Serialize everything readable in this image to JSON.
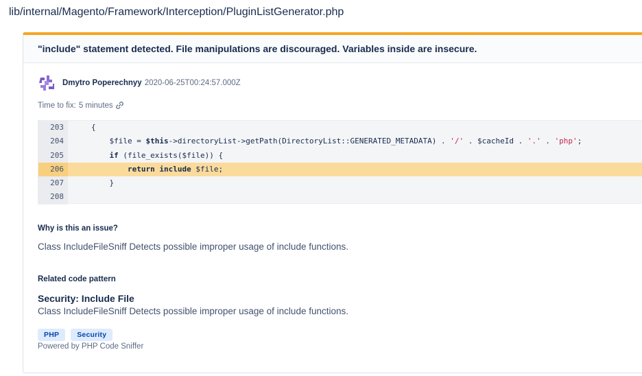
{
  "file": {
    "path": "lib/internal/Magento/Framework/Interception/PluginListGenerator.php"
  },
  "issue": {
    "title": "\"include\" statement detected. File manipulations are discouraged. Variables inside are insecure.",
    "author": "Dmytro Poperechnyy",
    "timestamp": "2020-06-25T00:24:57.000Z",
    "time_to_fix_label": "Time to fix:",
    "time_to_fix_value": "5 minutes",
    "accent_color": "#f5a623"
  },
  "code": {
    "highlight_line": 206,
    "lines": [
      {
        "number": "203",
        "segments": [
          {
            "t": "{",
            "c": ""
          }
        ]
      },
      {
        "number": "204",
        "segments": [
          {
            "t": "    $file = ",
            "c": ""
          },
          {
            "t": "$this",
            "c": "kw"
          },
          {
            "t": "->directoryList->getPath(DirectoryList::GENERATED_METADATA) . ",
            "c": ""
          },
          {
            "t": "'/'",
            "c": "str"
          },
          {
            "t": " . $cacheId . ",
            "c": ""
          },
          {
            "t": "'.'",
            "c": "str"
          },
          {
            "t": " . ",
            "c": ""
          },
          {
            "t": "'php'",
            "c": "str"
          },
          {
            "t": ";",
            "c": ""
          }
        ]
      },
      {
        "number": "205",
        "segments": [
          {
            "t": "    ",
            "c": ""
          },
          {
            "t": "if",
            "c": "kw"
          },
          {
            "t": " (file_exists($file)) {",
            "c": ""
          }
        ]
      },
      {
        "number": "206",
        "segments": [
          {
            "t": "        ",
            "c": ""
          },
          {
            "t": "return",
            "c": "kw"
          },
          {
            "t": " ",
            "c": ""
          },
          {
            "t": "include",
            "c": "kw"
          },
          {
            "t": " $file;",
            "c": ""
          }
        ]
      },
      {
        "number": "207",
        "segments": [
          {
            "t": "    }",
            "c": ""
          }
        ]
      },
      {
        "number": "208",
        "segments": [
          {
            "t": "",
            "c": ""
          }
        ]
      }
    ]
  },
  "why": {
    "heading": "Why is this an issue?",
    "text": "Class IncludeFileSniff Detects possible improper usage of include functions."
  },
  "pattern": {
    "heading": "Related code pattern",
    "title": "Security: Include File",
    "text": "Class IncludeFileSniff Detects possible improper usage of include functions."
  },
  "tags": [
    "PHP",
    "Security"
  ],
  "powered_by": "Powered by PHP Code Sniffer"
}
